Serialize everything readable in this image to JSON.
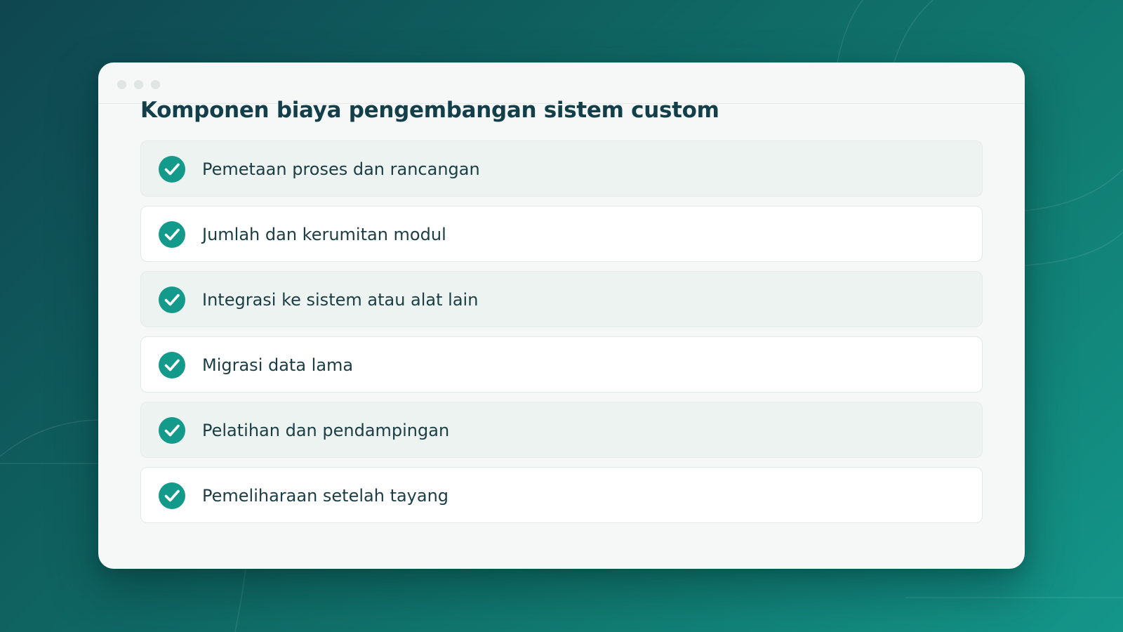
{
  "colors": {
    "accent": "#149a8a",
    "heading": "#123f49",
    "text": "#1b3d44",
    "card_bg": "#f6f8f7",
    "row_alt_bg": "#edf3f1",
    "row_bg": "#ffffff"
  },
  "window": {
    "title": "Komponen biaya pengembangan sistem custom"
  },
  "items": [
    {
      "label": "Pemetaan proses dan rancangan",
      "icon": "check-circle-icon"
    },
    {
      "label": "Jumlah dan kerumitan modul",
      "icon": "check-circle-icon"
    },
    {
      "label": "Integrasi ke sistem atau alat lain",
      "icon": "check-circle-icon"
    },
    {
      "label": "Migrasi data lama",
      "icon": "check-circle-icon"
    },
    {
      "label": "Pelatihan dan pendampingan",
      "icon": "check-circle-icon"
    },
    {
      "label": "Pemeliharaan setelah tayang",
      "icon": "check-circle-icon"
    }
  ]
}
